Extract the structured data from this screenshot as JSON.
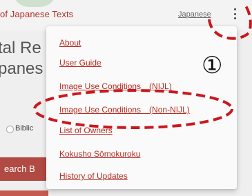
{
  "header": {
    "site_title": "of Japanese Texts",
    "language": "Japanese"
  },
  "background": {
    "heading_line1": "tal Re",
    "heading_line2": "panes",
    "radio_label": "Biblic",
    "search_button": "earch B"
  },
  "menu": {
    "items": [
      "About",
      "User Guide",
      "Image Use Conditions　(NIJL)",
      "Image Use Conditions　(Non-NIJL)",
      "List of Owners",
      "Kokusho Sōmokuroku",
      "History of Updates"
    ]
  },
  "annotation": {
    "step_number": "①",
    "highlight_color": "#c8191e"
  }
}
